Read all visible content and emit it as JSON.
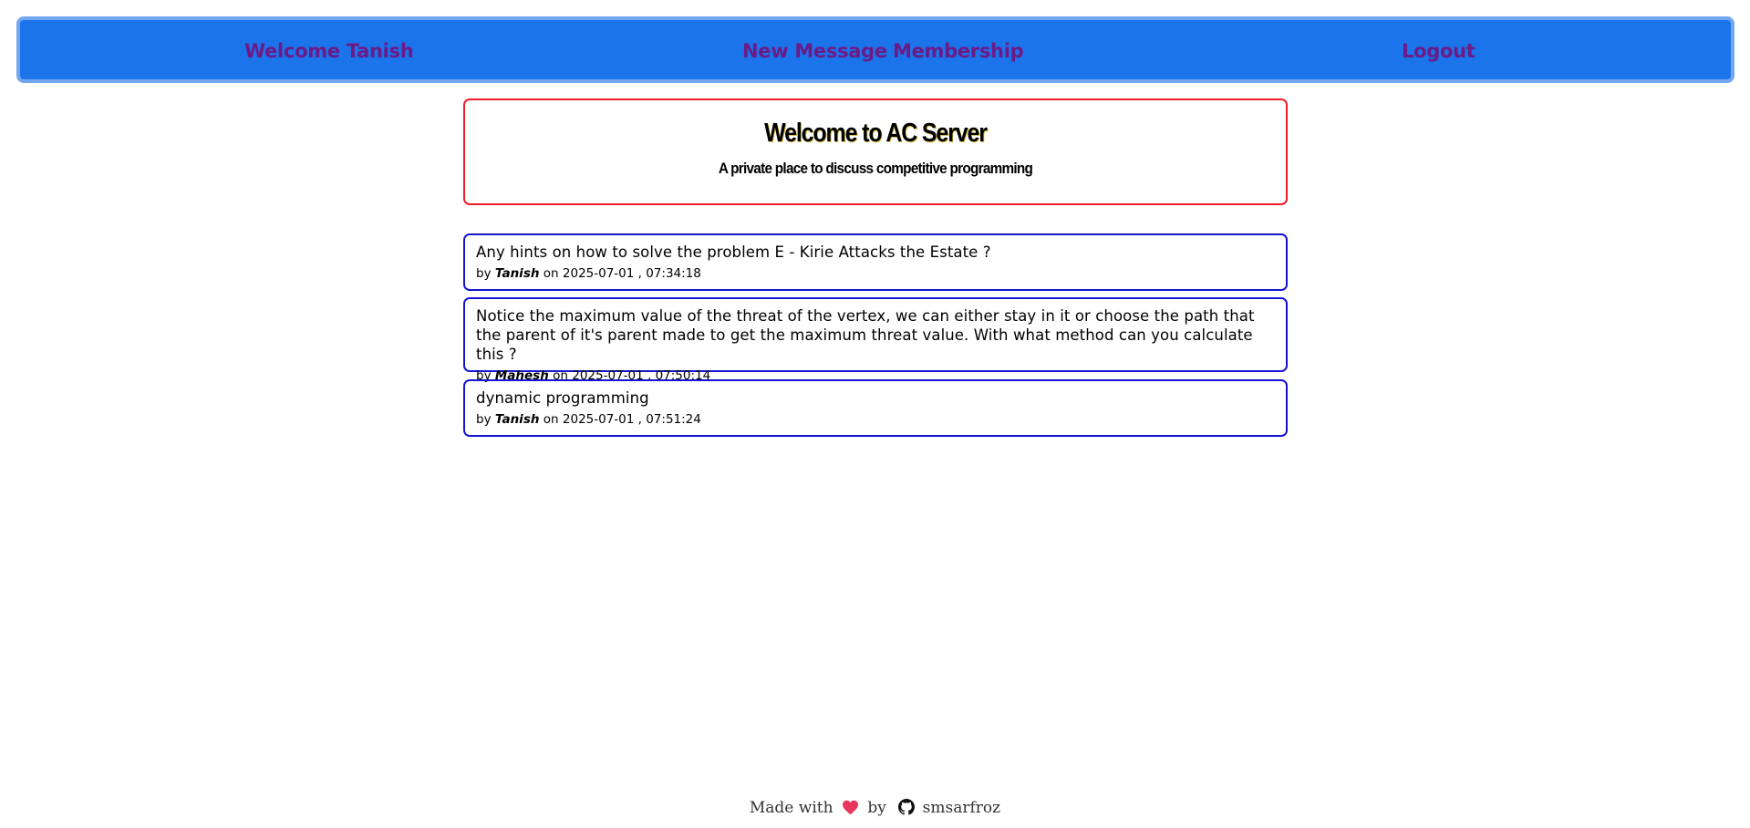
{
  "navbar": {
    "welcome": "Welcome Tanish",
    "new_message": "New Message",
    "membership": "Membership",
    "logout": "Logout"
  },
  "hero": {
    "title": "Welcome to AC Server",
    "subtitle": "A private place to discuss competitive programming"
  },
  "messages": [
    {
      "text": "Any hints on how to solve the problem E - Kirie Attacks the Estate ?",
      "by": "by",
      "author": "Tanish",
      "on": "on",
      "timestamp": "2025-07-01 , 07:34:18"
    },
    {
      "text": "Notice the maximum value of the threat of the vertex, we can either stay in it or choose the path that the parent of it's parent made to get the maximum threat value. With what method can you calculate this ?",
      "by": "by",
      "author": "Mahesh",
      "on": "on",
      "timestamp": "2025-07-01 , 07:50:14"
    },
    {
      "text": "dynamic programming",
      "by": "by",
      "author": "Tanish",
      "on": "on",
      "timestamp": "2025-07-01 , 07:51:24"
    }
  ],
  "footer": {
    "made_with": "Made with",
    "by": "by",
    "author": "smsarfroz",
    "heart_icon": "heart-icon",
    "github_icon": "github-icon"
  },
  "colors": {
    "navbar_bg": "#1c74eb",
    "navbar_border": "#74a6ee",
    "nav_link": "#6b1a86",
    "hero_border": "#ee1c2a",
    "message_border": "#1414d2",
    "heart": "#e8365d"
  }
}
